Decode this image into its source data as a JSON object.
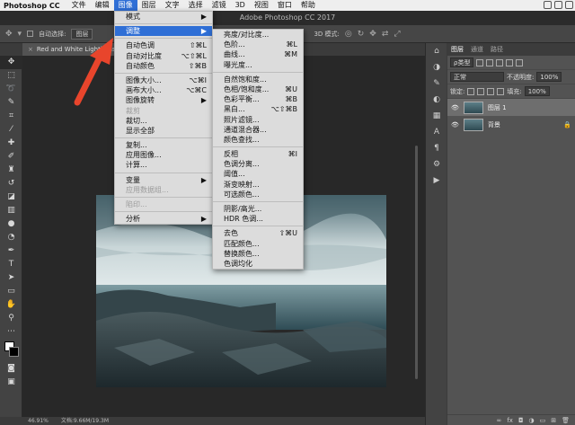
{
  "menubar": {
    "app_name": "Photoshop CC",
    "items": [
      "文件",
      "编辑",
      "图像",
      "图层",
      "文字",
      "选择",
      "滤镜",
      "3D",
      "视图",
      "窗口",
      "帮助"
    ],
    "active": "图像"
  },
  "window_title": "Adobe Photoshop CC 2017",
  "options_bar": {
    "auto_select_label": "自动选择:",
    "auto_select_value": "图层",
    "mode_3d_label": "3D 模式:"
  },
  "document_tab": {
    "name": "Red and White Lighthouse"
  },
  "status_bar": {
    "zoom": "46.91%",
    "doc_info": "文档:9.66M/19.3M"
  },
  "image_menu": [
    {
      "label": "模式",
      "shortcut": "▶"
    },
    {
      "sep": true
    },
    {
      "label": "调整",
      "shortcut": "▶",
      "highlight": true
    },
    {
      "sep": true
    },
    {
      "label": "自动色调",
      "shortcut": "⇧⌘L"
    },
    {
      "label": "自动对比度",
      "shortcut": "⌥⇧⌘L"
    },
    {
      "label": "自动颜色",
      "shortcut": "⇧⌘B"
    },
    {
      "sep": true
    },
    {
      "label": "图像大小...",
      "shortcut": "⌥⌘I"
    },
    {
      "label": "画布大小...",
      "shortcut": "⌥⌘C"
    },
    {
      "label": "图像旋转",
      "shortcut": "▶"
    },
    {
      "label": "裁剪",
      "disabled": true
    },
    {
      "label": "裁切..."
    },
    {
      "label": "显示全部"
    },
    {
      "sep": true
    },
    {
      "label": "复制..."
    },
    {
      "label": "应用图像..."
    },
    {
      "label": "计算..."
    },
    {
      "sep": true
    },
    {
      "label": "变量",
      "shortcut": "▶"
    },
    {
      "label": "应用数据组...",
      "disabled": true
    },
    {
      "sep": true
    },
    {
      "label": "陷印...",
      "disabled": true
    },
    {
      "sep": true
    },
    {
      "label": "分析",
      "shortcut": "▶"
    }
  ],
  "adjust_menu": [
    {
      "label": "亮度/对比度..."
    },
    {
      "label": "色阶...",
      "shortcut": "⌘L"
    },
    {
      "label": "曲线...",
      "shortcut": "⌘M"
    },
    {
      "label": "曝光度..."
    },
    {
      "sep": true
    },
    {
      "label": "自然饱和度..."
    },
    {
      "label": "色相/饱和度...",
      "shortcut": "⌘U"
    },
    {
      "label": "色彩平衡...",
      "shortcut": "⌘B"
    },
    {
      "label": "黑白...",
      "shortcut": "⌥⇧⌘B"
    },
    {
      "label": "照片滤镜..."
    },
    {
      "label": "通道混合器..."
    },
    {
      "label": "颜色查找..."
    },
    {
      "sep": true
    },
    {
      "label": "反相",
      "shortcut": "⌘I"
    },
    {
      "label": "色调分离..."
    },
    {
      "label": "阈值..."
    },
    {
      "label": "渐变映射..."
    },
    {
      "label": "可选颜色..."
    },
    {
      "sep": true
    },
    {
      "label": "阴影/高光..."
    },
    {
      "label": "HDR 色调..."
    },
    {
      "sep": true
    },
    {
      "label": "去色",
      "shortcut": "⇧⌘U"
    },
    {
      "label": "匹配颜色..."
    },
    {
      "label": "替换颜色..."
    },
    {
      "label": "色调均化"
    }
  ],
  "layers_panel": {
    "tabs": [
      "图层",
      "通道",
      "路径"
    ],
    "filter_label": "ρ类型",
    "blend_mode": "正常",
    "opacity_label": "不透明度:",
    "opacity_value": "100%",
    "lock_label": "锁定:",
    "fill_label": "填充:",
    "fill_value": "100%",
    "layers": [
      {
        "name": "图层 1",
        "active": true
      },
      {
        "name": "背景",
        "locked": true
      }
    ]
  },
  "colors": {
    "menu_highlight": "#2f6fd6",
    "arrow": "#e8452c"
  }
}
